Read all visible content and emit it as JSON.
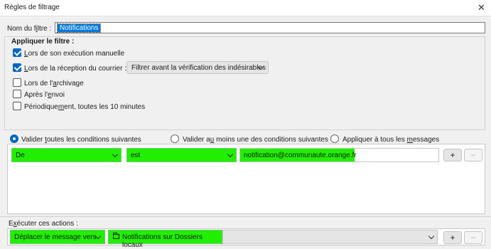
{
  "window": {
    "title": "Règles de filtrage",
    "close_icon": "close-icon"
  },
  "filter_name": {
    "label": "Nom du filtre :",
    "value": "Notifications"
  },
  "apply": {
    "title": "Appliquer le filtre :",
    "options": [
      {
        "label": "Lors de son exécution manuelle",
        "checked": true
      },
      {
        "label": "Lors de la réception du courrier :",
        "checked": true
      },
      {
        "label": "Lors de l'archivage",
        "checked": false
      },
      {
        "label": "Après l'envoi",
        "checked": false
      },
      {
        "label": "Périodiquement, toutes les 10 minutes",
        "checked": false
      }
    ],
    "receive_timing": "Filtrer avant la vérification des indésirables"
  },
  "match": {
    "options": [
      {
        "label": "Valider toutes les conditions suivantes",
        "selected": true
      },
      {
        "label": "Valider au moins une des conditions suivantes",
        "selected": false
      },
      {
        "label": "Appliquer à tous les messages",
        "selected": false
      }
    ]
  },
  "condition": {
    "field": "De",
    "operator": "est",
    "value": "notification@communaute.orange.fr",
    "add_label": "+",
    "remove_label": "−"
  },
  "actions": {
    "label": "Exécuter ces actions :",
    "action": "Déplacer le message vers",
    "target": "Notifications sur Dossiers locaux",
    "add_label": "+",
    "remove_label": "−"
  },
  "colors": {
    "highlight": "#22ee00",
    "accent": "#0067c0"
  }
}
